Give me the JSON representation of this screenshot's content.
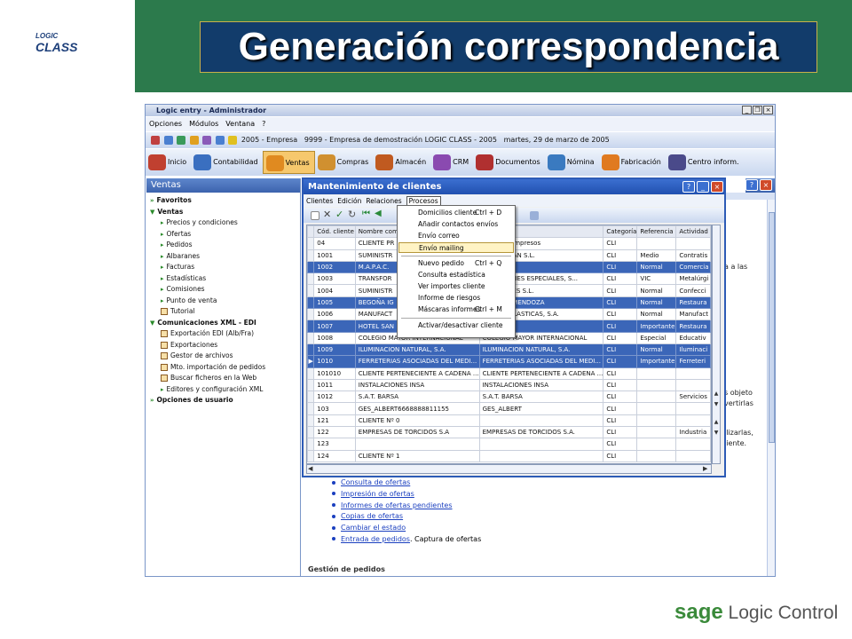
{
  "slide": {
    "title": "Generación correspondencia",
    "logo_top": "LOGIC",
    "logo_bottom": "CLASS",
    "footer_brand": "sage",
    "footer_text": "Logic Control"
  },
  "app": {
    "title": "Logic entry - Administrador",
    "menu": [
      "Opciones",
      "Módulos",
      "Ventana",
      "?"
    ],
    "info": {
      "year": "2005 - Empresa",
      "company": "9999 - Empresa de demostración LOGIC CLASS - 2005",
      "date": "martes, 29 de marzo de 2005"
    },
    "toolbar": [
      {
        "label": "Inicio",
        "icon": "home-icon",
        "active": false
      },
      {
        "label": "Contabilidad",
        "icon": "accounting-icon",
        "active": false
      },
      {
        "label": "Ventas",
        "icon": "sales-icon",
        "active": true
      },
      {
        "label": "Compras",
        "icon": "purchases-icon",
        "active": false
      },
      {
        "label": "Almacén",
        "icon": "warehouse-icon",
        "active": false
      },
      {
        "label": "CRM",
        "icon": "crm-icon",
        "active": false
      },
      {
        "label": "Documentos",
        "icon": "documents-icon",
        "active": false
      },
      {
        "label": "Nómina",
        "icon": "payroll-icon",
        "active": false
      },
      {
        "label": "Fabricación",
        "icon": "manufacturing-icon",
        "active": false
      },
      {
        "label": "Centro inform.",
        "icon": "info-center-icon",
        "active": false
      }
    ],
    "accent": "#3b66b8"
  },
  "sidebar": {
    "title": "Ventas",
    "items": [
      {
        "label": "Favoritos",
        "level": 1,
        "icon": "arrow"
      },
      {
        "label": "Ventas",
        "level": 1,
        "icon": "arrow-down"
      },
      {
        "label": "Precios y condiciones",
        "level": 2,
        "icon": "arrow"
      },
      {
        "label": "Ofertas",
        "level": 2,
        "icon": "arrow"
      },
      {
        "label": "Pedidos",
        "level": 2,
        "icon": "arrow"
      },
      {
        "label": "Albaranes",
        "level": 2,
        "icon": "arrow"
      },
      {
        "label": "Facturas",
        "level": 2,
        "icon": "arrow"
      },
      {
        "label": "Estadísticas",
        "level": 2,
        "icon": "arrow"
      },
      {
        "label": "Comisiones",
        "level": 2,
        "icon": "arrow"
      },
      {
        "label": "Punto de venta",
        "level": 2,
        "icon": "arrow"
      },
      {
        "label": "Tutorial",
        "level": 2,
        "icon": "doc"
      },
      {
        "label": "Comunicaciones XML - EDI",
        "level": 1,
        "icon": "arrow-down"
      },
      {
        "label": "Exportación EDI (Alb/Fra)",
        "level": 2,
        "icon": "doc"
      },
      {
        "label": "Exportaciones",
        "level": 2,
        "icon": "doc"
      },
      {
        "label": "Gestor de archivos",
        "level": 2,
        "icon": "doc"
      },
      {
        "label": "Mto. importación de pedidos",
        "level": 2,
        "icon": "doc"
      },
      {
        "label": "Buscar ficheros en la Web",
        "level": 2,
        "icon": "doc"
      },
      {
        "label": "Editores y configuración XML",
        "level": 2,
        "icon": "arrow"
      },
      {
        "label": "Opciones de usuario",
        "level": 1,
        "icon": "arrow"
      }
    ]
  },
  "background": {
    "text_right_1": "a a las",
    "text_right_2": "s objeto",
    "text_right_3": "vertirlas",
    "text_right_4": "ilizarlas,",
    "text_right_5": "liente.",
    "links": [
      {
        "label": "Consulta de ofertas",
        "suffix": ""
      },
      {
        "label": "Impresión de ofertas",
        "suffix": ""
      },
      {
        "label": "Informes de ofertas pendientes",
        "suffix": ""
      },
      {
        "label": "Copias de ofertas",
        "suffix": ""
      },
      {
        "label": "Cambiar el estado",
        "suffix": ""
      },
      {
        "label": "Entrada de pedidos",
        "suffix": ". Captura de ofertas"
      }
    ],
    "section": "Gestión de pedidos"
  },
  "dialog": {
    "title": "Mantenimiento de clientes",
    "menu": [
      "Clientes",
      "Edición",
      "Relaciones",
      "Procesos"
    ],
    "columns": [
      "Cód. cliente",
      "Nombre com",
      "",
      "Categoría",
      "Referencia",
      "Actividad"
    ],
    "rows": [
      {
        "code": "04",
        "name": "CLIENTE PR",
        "name2": "roveedor Impresos",
        "cat": "CLI",
        "ref": "",
        "act": "",
        "sel": false,
        "mark": ""
      },
      {
        "code": "1001",
        "name": "SUMINISTR",
        "name2": "ROS TAIWAN S.L.",
        "cat": "CLI",
        "ref": "Medio",
        "act": "Contratis",
        "sel": false,
        "mark": ""
      },
      {
        "code": "1002",
        "name": "M.A.P.A.C.",
        "name2": ".C.A.S.A.",
        "cat": "CLI",
        "ref": "Normal",
        "act": "Comercia",
        "sel": true,
        "mark": ""
      },
      {
        "code": "1003",
        "name": "TRANSFOR",
        "name2": "ORMACIONES ESPECIALES, S...",
        "cat": "CLI",
        "ref": "VIC",
        "act": "Metalúrgi",
        "sel": false,
        "mark": ""
      },
      {
        "code": "1004",
        "name": "SUMINISTR",
        "name2": "ROS VALLÉS S.L.",
        "cat": "CLI",
        "ref": "Normal",
        "act": "Confecci",
        "sel": false,
        "mark": ""
      },
      {
        "code": "1005",
        "name": "BEGOÑA IG",
        "name2": "IGLESIAS MENDOZA",
        "cat": "CLI",
        "ref": "Normal",
        "act": "Restaura",
        "sel": true,
        "mark": ""
      },
      {
        "code": "1006",
        "name": "MANUFACT",
        "name2": "CTURAS PLASTICAS, S.A.",
        "cat": "CLI",
        "ref": "Normal",
        "act": "Manufact",
        "sel": false,
        "mark": ""
      },
      {
        "code": "1007",
        "name": "HOTEL SAN",
        "name2": "N PEDRO",
        "cat": "CLI",
        "ref": "Importante",
        "act": "Restaura",
        "sel": true,
        "mark": ""
      },
      {
        "code": "1008",
        "name": "COLEGIO MAYOR INTERNACIONAL",
        "name2": "COLEGIO MAYOR INTERNACIONAL",
        "cat": "CLI",
        "ref": "Especial",
        "act": "Educativ",
        "sel": false,
        "mark": ""
      },
      {
        "code": "1009",
        "name": "ILUMINACION NATURAL, S.A.",
        "name2": "ILUMINACION NATURAL, S.A.",
        "cat": "CLI",
        "ref": "Normal",
        "act": "Iluminaci",
        "sel": true,
        "mark": ""
      },
      {
        "code": "1010",
        "name": "FERRETERIAS ASOCIADAS DEL MEDI...",
        "name2": "FERRETERIAS ASOCIADAS DEL MEDI...",
        "cat": "CLI",
        "ref": "Importante",
        "act": "Ferreteri",
        "sel": true,
        "mark": "▶"
      },
      {
        "code": "101010",
        "name": "CLIENTE PERTENECIENTE A CADENA ...",
        "name2": "CLIENTE PERTENECIENTE A CADENA ...",
        "cat": "CLI",
        "ref": "",
        "act": "",
        "sel": false,
        "mark": ""
      },
      {
        "code": "1011",
        "name": "INSTALACIONES INSA",
        "name2": "INSTALACIONES INSA",
        "cat": "CLI",
        "ref": "",
        "act": "",
        "sel": false,
        "mark": ""
      },
      {
        "code": "1012",
        "name": "S.A.T. BARSA",
        "name2": "S.A.T. BARSA",
        "cat": "CLI",
        "ref": "",
        "act": "Servicios",
        "sel": false,
        "mark": ""
      },
      {
        "code": "103",
        "name": "GES_ALBERT6668888811155",
        "name2": "GES_ALBERT",
        "cat": "CLI",
        "ref": "",
        "act": "",
        "sel": false,
        "mark": ""
      },
      {
        "code": "121",
        "name": "CLIENTE Nº 0",
        "name2": "",
        "cat": "CLI",
        "ref": "",
        "act": "",
        "sel": false,
        "mark": ""
      },
      {
        "code": "122",
        "name": "EMPRESAS DE TORCIDOS S.A",
        "name2": "EMPRESAS DE TORCIDOS S.A.",
        "cat": "CLI",
        "ref": "",
        "act": "Industria",
        "sel": false,
        "mark": ""
      },
      {
        "code": "123",
        "name": "",
        "name2": "",
        "cat": "CLI",
        "ref": "",
        "act": "",
        "sel": false,
        "mark": ""
      },
      {
        "code": "124",
        "name": "CLIENTE Nº 1",
        "name2": "",
        "cat": "CLI",
        "ref": "",
        "act": "",
        "sel": false,
        "mark": ""
      }
    ]
  },
  "dropdown": {
    "items": [
      {
        "label": "Domicilios cliente",
        "shortcut": "Ctrl + D",
        "highlight": false,
        "sep_after": false
      },
      {
        "label": "Añadir contactos envíos",
        "shortcut": "",
        "highlight": false,
        "sep_after": false
      },
      {
        "label": "Envío correo",
        "shortcut": "",
        "highlight": false,
        "sep_after": false
      },
      {
        "label": "Envío mailing",
        "shortcut": "",
        "highlight": true,
        "sep_after": true
      },
      {
        "label": "Nuevo pedido",
        "shortcut": "Ctrl + Q",
        "highlight": false,
        "sep_after": false
      },
      {
        "label": "Consulta estadística",
        "shortcut": "",
        "highlight": false,
        "sep_after": false
      },
      {
        "label": "Ver importes cliente",
        "shortcut": "",
        "highlight": false,
        "sep_after": false
      },
      {
        "label": "Informe de riesgos",
        "shortcut": "",
        "highlight": false,
        "sep_after": false
      },
      {
        "label": "Máscaras informes",
        "shortcut": "Ctrl + M",
        "highlight": false,
        "sep_after": true
      },
      {
        "label": "Activar/desactivar cliente",
        "shortcut": "",
        "highlight": false,
        "sep_after": false
      }
    ]
  }
}
